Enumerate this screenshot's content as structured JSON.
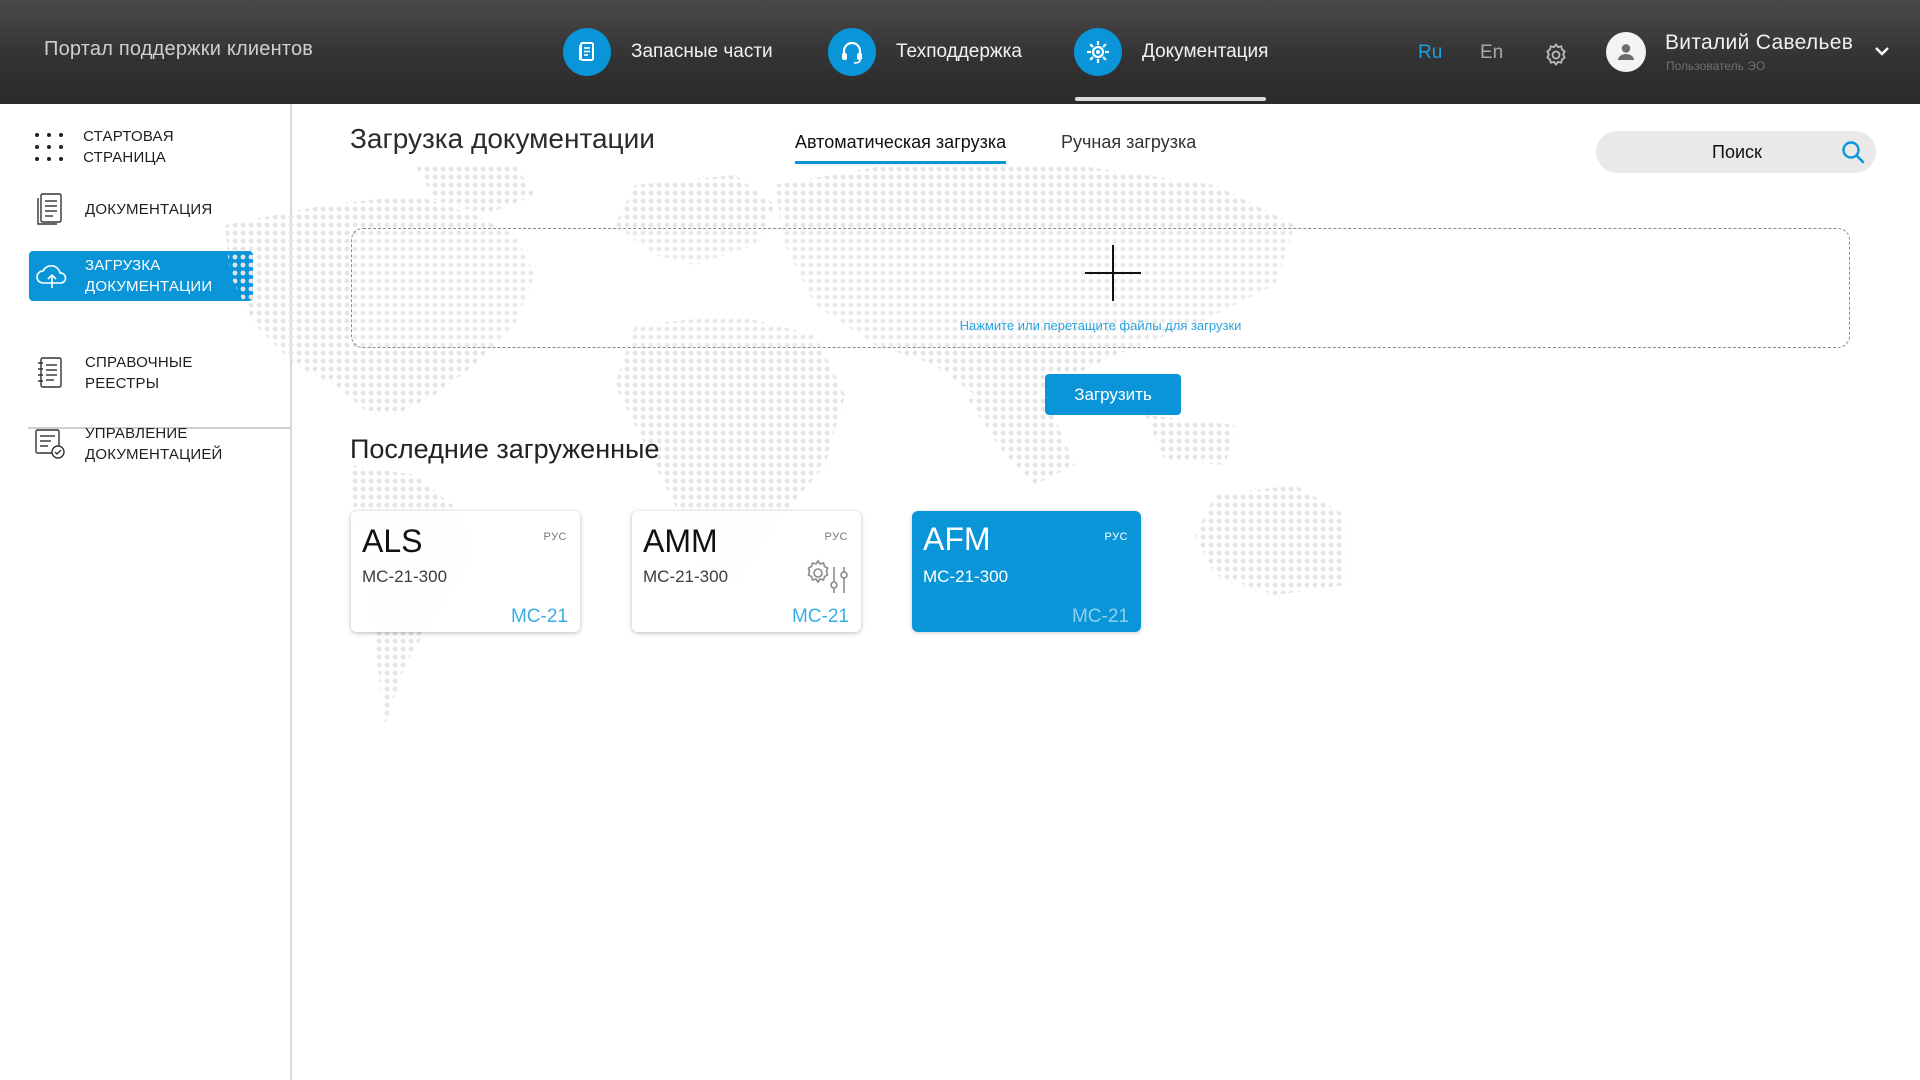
{
  "header": {
    "brand": "Портал поддержки клиентов",
    "nav": [
      {
        "label": "Запасные части",
        "icon": "document-icon"
      },
      {
        "label": "Техподдержка",
        "icon": "headset-icon"
      },
      {
        "label": "Документация",
        "icon": "gear-doc-icon",
        "active": true
      }
    ],
    "languages": {
      "ru": "Ru",
      "en": "En",
      "selected": "Ru"
    },
    "user": {
      "name": "Виталий Савельев",
      "role": "Пользователь ЭО"
    }
  },
  "sidebar": {
    "items": [
      {
        "label": "СТАРТОВАЯ СТРАНИЦА",
        "icon": "grid-dots-icon"
      },
      {
        "label": "ДОКУМЕНТАЦИЯ",
        "icon": "document-list-icon"
      },
      {
        "label_line1": "ЗАГРУЗКА",
        "label_line2": "ДОКУМЕНТАЦИИ",
        "icon": "cloud-upload-icon",
        "active": true
      },
      {
        "label_line1": "СПРАВОЧНЫЕ",
        "label_line2": "РЕЕСТРЫ",
        "icon": "registry-icon"
      },
      {
        "label_line1": "УПРАВЛЕНИЕ",
        "label_line2": "ДОКУМЕНТАЦИЕЙ",
        "icon": "doc-management-icon"
      }
    ]
  },
  "main": {
    "title": "Загрузка документации",
    "tabs": [
      {
        "label": "Автоматическая загрузка",
        "active": true
      },
      {
        "label": "Ручная загрузка"
      }
    ],
    "search_label": "Поиск",
    "dropzone_hint": "Нажмите или перетащите файлы для загрузки",
    "upload_button": "Загрузить",
    "recent_title": "Последние загруженные",
    "cards": [
      {
        "code": "ALS",
        "model": "МС-21-300",
        "lang": "РУС",
        "family": "МС-21"
      },
      {
        "code": "AMM",
        "model": "МС-21-300",
        "lang": "РУС",
        "family": "МС-21",
        "settings_icon": true
      },
      {
        "code": "AFM",
        "model": "МС-21-300",
        "lang": "РУС",
        "family": "МС-21",
        "selected": true
      }
    ]
  },
  "colors": {
    "accent": "#0a95d8",
    "topbar": "#333333"
  }
}
